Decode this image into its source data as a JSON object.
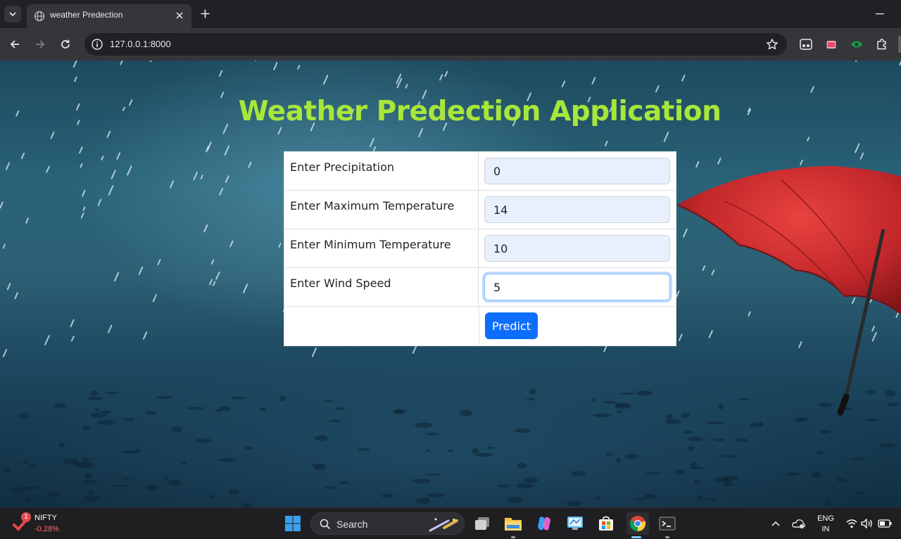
{
  "browser": {
    "tab_title": "weather Predection",
    "url": "127.0.0.1:8000"
  },
  "page": {
    "heading": "Weather Predection Application",
    "title_color": "#a8e63a",
    "fields": [
      {
        "label": "Enter Precipitation",
        "value": "0"
      },
      {
        "label": "Enter Maximum Temperature",
        "value": "14"
      },
      {
        "label": "Enter Minimum Temperature",
        "value": "10"
      },
      {
        "label": "Enter Wind Speed",
        "value": "5"
      }
    ],
    "submit_label": "Predict",
    "submit_color": "#0d6efd"
  },
  "taskbar": {
    "stock_name": "NIFTY",
    "stock_change": "-0.28%",
    "notification_count": "1",
    "search_label": "Search",
    "language_line1": "ENG",
    "language_line2": "IN"
  }
}
